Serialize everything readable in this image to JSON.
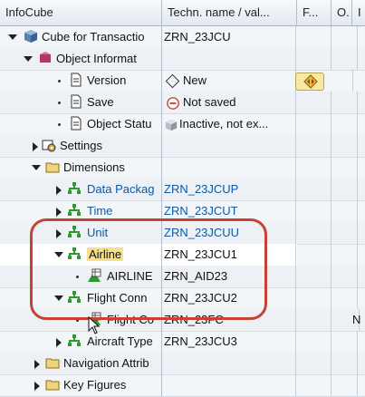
{
  "header": {
    "col1": "InfoCube",
    "col2": "Techn. name / val...",
    "col3": "F...",
    "col4": "O.",
    "col5": "I"
  },
  "rows": [
    {
      "label": "Cube for Transactio",
      "value": "ZRN_23JCU"
    },
    {
      "label": "Object Informat",
      "value": ""
    },
    {
      "label": "Version",
      "value": "New"
    },
    {
      "label": "Save",
      "value": "Not saved"
    },
    {
      "label": "Object Statu",
      "value": "Inactive, not ex..."
    },
    {
      "label": "Settings",
      "value": ""
    },
    {
      "label": "Dimensions",
      "value": ""
    },
    {
      "label": "Data Packag",
      "value": "ZRN_23JCUP"
    },
    {
      "label": "Time",
      "value": "ZRN_23JCUT"
    },
    {
      "label": "Unit",
      "value": "ZRN_23JCUU"
    },
    {
      "label": "Airline",
      "value": "ZRN_23JCU1"
    },
    {
      "label": "AIRLINE",
      "value": "ZRN_AID23"
    },
    {
      "label": "Flight Conn",
      "value": "ZRN_23JCU2"
    },
    {
      "label": "Flight Co",
      "value": "ZRN_23FC",
      "extra": "N"
    },
    {
      "label": "Aircraft Type",
      "value": "ZRN_23JCU3"
    },
    {
      "label": "Navigation Attrib",
      "value": ""
    },
    {
      "label": "Key Figures",
      "value": ""
    }
  ],
  "colors": {
    "highlight_oval": "#c44433",
    "blue_text": "#0a5aa3",
    "selected_tag": "#f6e08a",
    "tree_green": "#2e9a2e",
    "folder_yellow": "#f0d47a"
  }
}
